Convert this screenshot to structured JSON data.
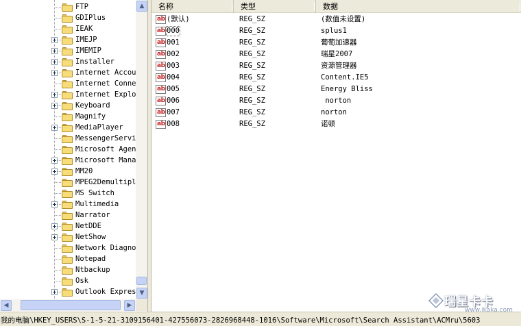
{
  "tree": {
    "items": [
      {
        "label": "FTP",
        "expandable": false
      },
      {
        "label": "GDIPlus",
        "expandable": false
      },
      {
        "label": "IEAK",
        "expandable": false
      },
      {
        "label": "IMEJP",
        "expandable": true
      },
      {
        "label": "IMEMIP",
        "expandable": true
      },
      {
        "label": "Installer",
        "expandable": true
      },
      {
        "label": "Internet Accou",
        "expandable": true
      },
      {
        "label": "Internet Conne",
        "expandable": false
      },
      {
        "label": "Internet Explo",
        "expandable": true
      },
      {
        "label": "Keyboard",
        "expandable": true
      },
      {
        "label": "Magnify",
        "expandable": false
      },
      {
        "label": "MediaPlayer",
        "expandable": true
      },
      {
        "label": "MessengerServi",
        "expandable": false
      },
      {
        "label": "Microsoft Agen",
        "expandable": false
      },
      {
        "label": "Microsoft Mana",
        "expandable": true
      },
      {
        "label": "MM20",
        "expandable": true
      },
      {
        "label": "MPEG2Demultipl",
        "expandable": false
      },
      {
        "label": "MS Switch",
        "expandable": false
      },
      {
        "label": "Multimedia",
        "expandable": true
      },
      {
        "label": "Narrator",
        "expandable": false
      },
      {
        "label": "NetDDE",
        "expandable": true
      },
      {
        "label": "NetShow",
        "expandable": true
      },
      {
        "label": "Network Diagno",
        "expandable": false
      },
      {
        "label": "Notepad",
        "expandable": false
      },
      {
        "label": "Ntbackup",
        "expandable": false
      },
      {
        "label": "Osk",
        "expandable": false
      },
      {
        "label": "Outlook Expres",
        "expandable": true
      }
    ]
  },
  "list": {
    "columns": [
      "名称",
      "类型",
      "数据"
    ],
    "value_icon": "ab",
    "rows": [
      {
        "name": "(默认)",
        "type": "REG_SZ",
        "data": "(数值未设置)"
      },
      {
        "name": "000",
        "type": "REG_SZ",
        "data": "splus1"
      },
      {
        "name": "001",
        "type": "REG_SZ",
        "data": "葡萄加速器"
      },
      {
        "name": "002",
        "type": "REG_SZ",
        "data": "瑞星2007"
      },
      {
        "name": "003",
        "type": "REG_SZ",
        "data": "资源管理器"
      },
      {
        "name": "004",
        "type": "REG_SZ",
        "data": "Content.IE5"
      },
      {
        "name": "005",
        "type": "REG_SZ",
        "data": "Energy Bliss"
      },
      {
        "name": "006",
        "type": "REG_SZ",
        "data": " norton"
      },
      {
        "name": "007",
        "type": "REG_SZ",
        "data": "norton"
      },
      {
        "name": "008",
        "type": "REG_SZ",
        "data": "诺顿"
      }
    ]
  },
  "status": {
    "path": "我的电脑\\HKEY_USERS\\S-1-5-21-3109156401-427556073-2826968448-1016\\Software\\Microsoft\\Search Assistant\\ACMru\\5603"
  },
  "watermark": {
    "title": "瑞星卡卡",
    "url": "www.ikaka.com"
  },
  "scroll": {
    "up_arrow": "▲",
    "down_arrow": "▼",
    "left_arrow": "◀",
    "right_arrow": "▶"
  },
  "colors": {
    "value_icon_text": "#c62020",
    "folder": "#f7dc7a",
    "scrollbar": "#c6d3f7",
    "chrome": "#ece9d8"
  }
}
